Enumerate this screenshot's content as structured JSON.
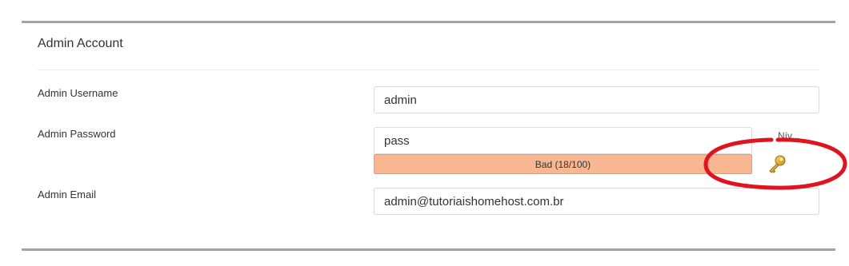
{
  "section": {
    "title": "Admin Account"
  },
  "fields": {
    "username": {
      "label": "Admin Username",
      "value": "admin"
    },
    "password": {
      "label": "Admin Password",
      "value": "pass",
      "hint": "Nív..."
    },
    "email": {
      "label": "Admin Email",
      "value": "admin@tutoriaishomehost.com.br"
    }
  },
  "password_strength": {
    "label": "Bad (18/100)",
    "score": 18,
    "max": 100,
    "color": "#f9b791"
  },
  "icons": {
    "generate_password": "key-icon"
  },
  "annotation": {
    "color": "#e0141e"
  }
}
